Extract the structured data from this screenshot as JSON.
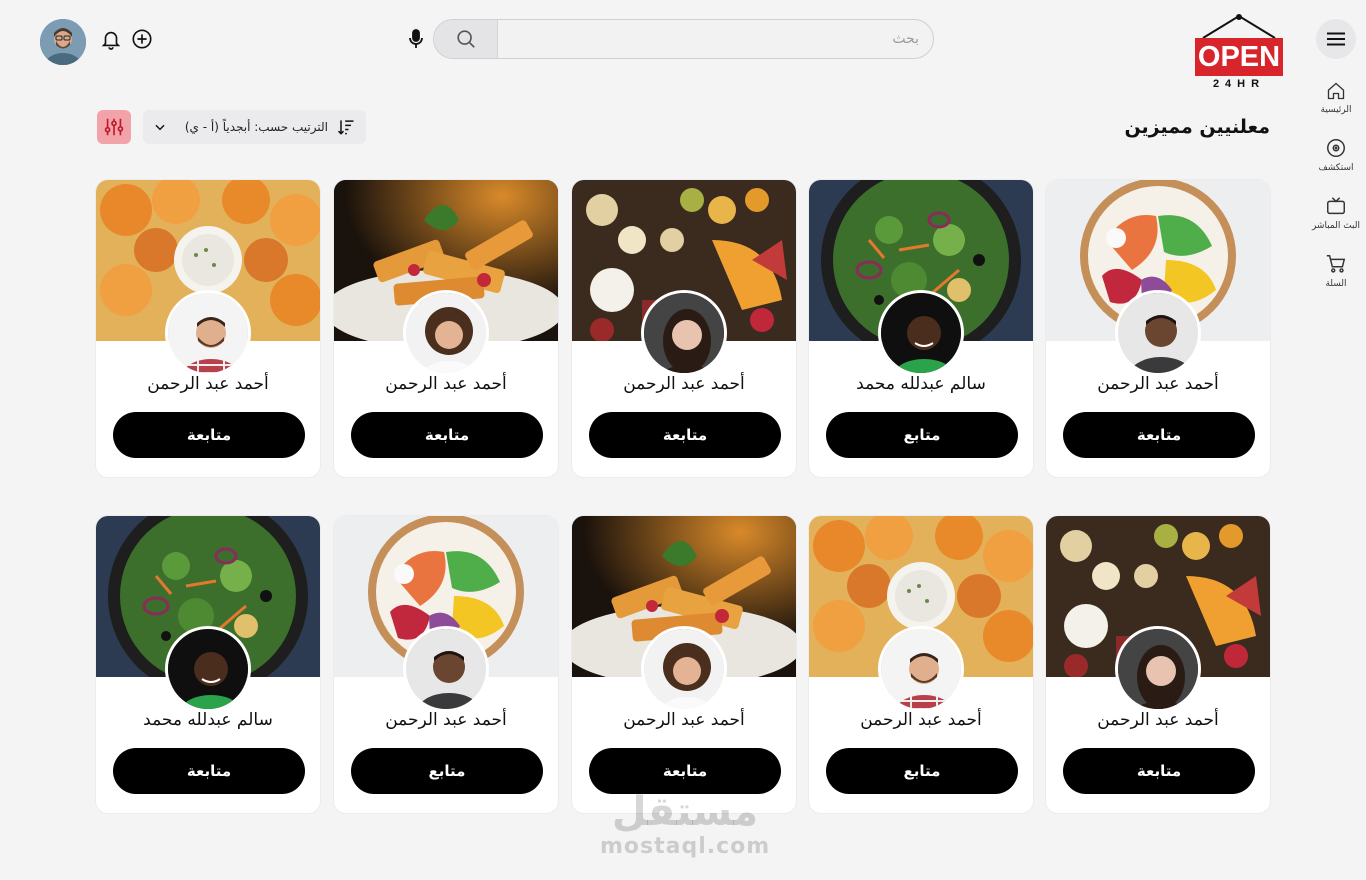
{
  "sidebar": {
    "items": [
      {
        "label": "الرئيسية",
        "icon": "home-icon"
      },
      {
        "label": "استكشف",
        "icon": "explore-icon"
      },
      {
        "label": "البث المباشر",
        "icon": "tv-icon"
      },
      {
        "label": "السلة",
        "icon": "cart-icon"
      }
    ]
  },
  "logo": {
    "open": "OPEN",
    "hours": "24HR"
  },
  "search": {
    "placeholder": "بحث"
  },
  "page": {
    "title": "معلنيين مميزين"
  },
  "sort": {
    "label": "الترتيب حسب: أبجدياً (أ - ي)"
  },
  "colors": {
    "accent": "#d8242b",
    "filter_bg": "#f2a3aa",
    "button": "#000000"
  },
  "cards": [
    {
      "name": "أحمد عبد الرحمن",
      "button": "متابعة",
      "cover": "poke-bowl",
      "avatar": "man-dark-shirt"
    },
    {
      "name": "سالم عبدلله محمد",
      "button": "متابع",
      "cover": "salad",
      "avatar": "man-green-shirt"
    },
    {
      "name": "أحمد عبد الرحمن",
      "button": "متابعة",
      "cover": "charcuterie",
      "avatar": "woman-dark-hair"
    },
    {
      "name": "أحمد عبد الرحمن",
      "button": "متابعة",
      "cover": "pasta",
      "avatar": "woman-curly-hair"
    },
    {
      "name": "أحمد عبد الرحمن",
      "button": "متابعة",
      "cover": "pastry-rolls",
      "avatar": "man-plaid-shirt"
    },
    {
      "name": "أحمد عبد الرحمن",
      "button": "متابعة",
      "cover": "charcuterie",
      "avatar": "woman-dark-hair"
    },
    {
      "name": "أحمد عبد الرحمن",
      "button": "متابع",
      "cover": "pastry-rolls",
      "avatar": "man-plaid-shirt"
    },
    {
      "name": "أحمد عبد الرحمن",
      "button": "متابعة",
      "cover": "pasta",
      "avatar": "woman-curly-hair"
    },
    {
      "name": "أحمد عبد الرحمن",
      "button": "متابع",
      "cover": "poke-bowl",
      "avatar": "man-dark-shirt"
    },
    {
      "name": "سالم عبدلله محمد",
      "button": "متابعة",
      "cover": "salad",
      "avatar": "man-green-shirt"
    }
  ],
  "watermark": {
    "line1": "مستقل",
    "line2": "mostaql.com"
  }
}
